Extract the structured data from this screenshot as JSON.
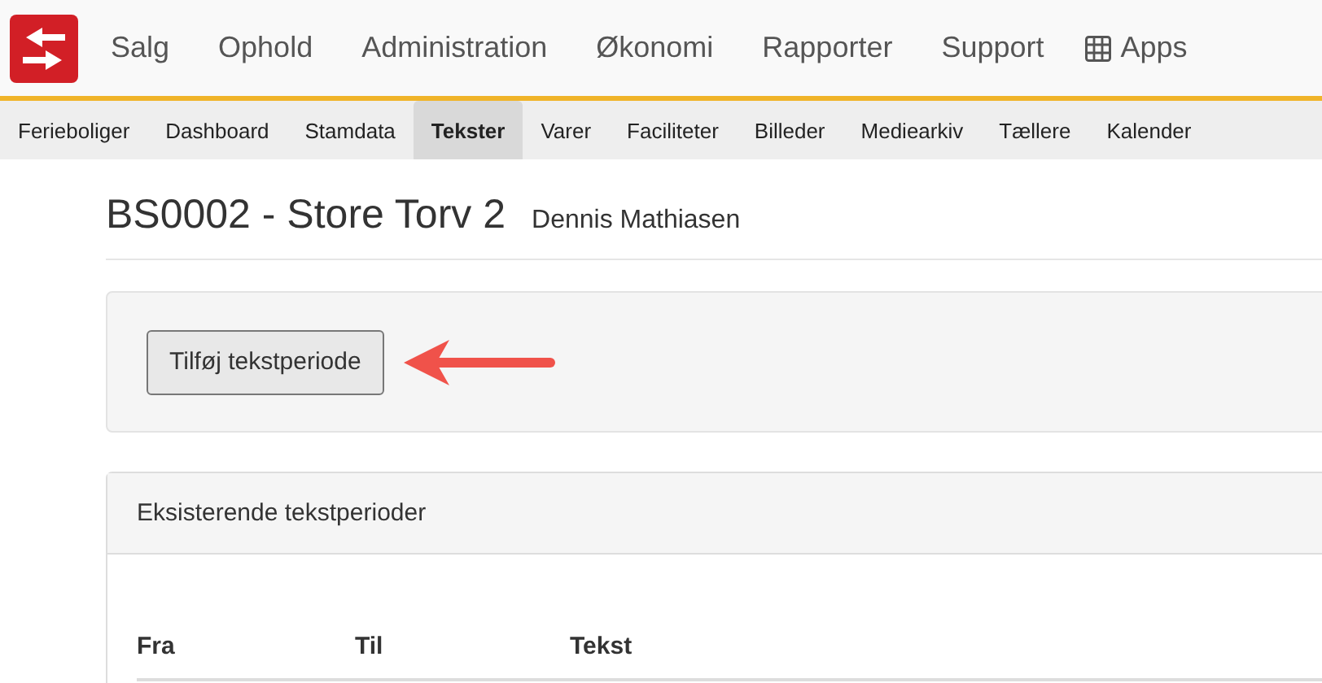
{
  "main_menu": [
    {
      "label": "Salg",
      "kind": "text"
    },
    {
      "label": "Ophold",
      "kind": "text"
    },
    {
      "label": "Administration",
      "kind": "text"
    },
    {
      "label": "Økonomi",
      "kind": "text"
    },
    {
      "label": "Rapporter",
      "kind": "text"
    },
    {
      "label": "Support",
      "kind": "text"
    },
    {
      "label": "Apps",
      "kind": "grid"
    }
  ],
  "tabs": [
    {
      "label": "Ferieboliger",
      "selected": false
    },
    {
      "label": "Dashboard",
      "selected": false
    },
    {
      "label": "Stamdata",
      "selected": false
    },
    {
      "label": "Tekster",
      "selected": true
    },
    {
      "label": "Varer",
      "selected": false
    },
    {
      "label": "Faciliteter",
      "selected": false
    },
    {
      "label": "Billeder",
      "selected": false
    },
    {
      "label": "Mediearkiv",
      "selected": false
    },
    {
      "label": "Tællere",
      "selected": false
    },
    {
      "label": "Kalender",
      "selected": false
    }
  ],
  "page": {
    "title": "BS0002 - Store Torv 2",
    "subtitle": "Dennis Mathiasen"
  },
  "add_button": "Tilføj tekstperiode",
  "periods_panel": {
    "heading": "Eksisterende tekstperioder",
    "columns": [
      "Fra",
      "Til",
      "Tekst"
    ]
  }
}
